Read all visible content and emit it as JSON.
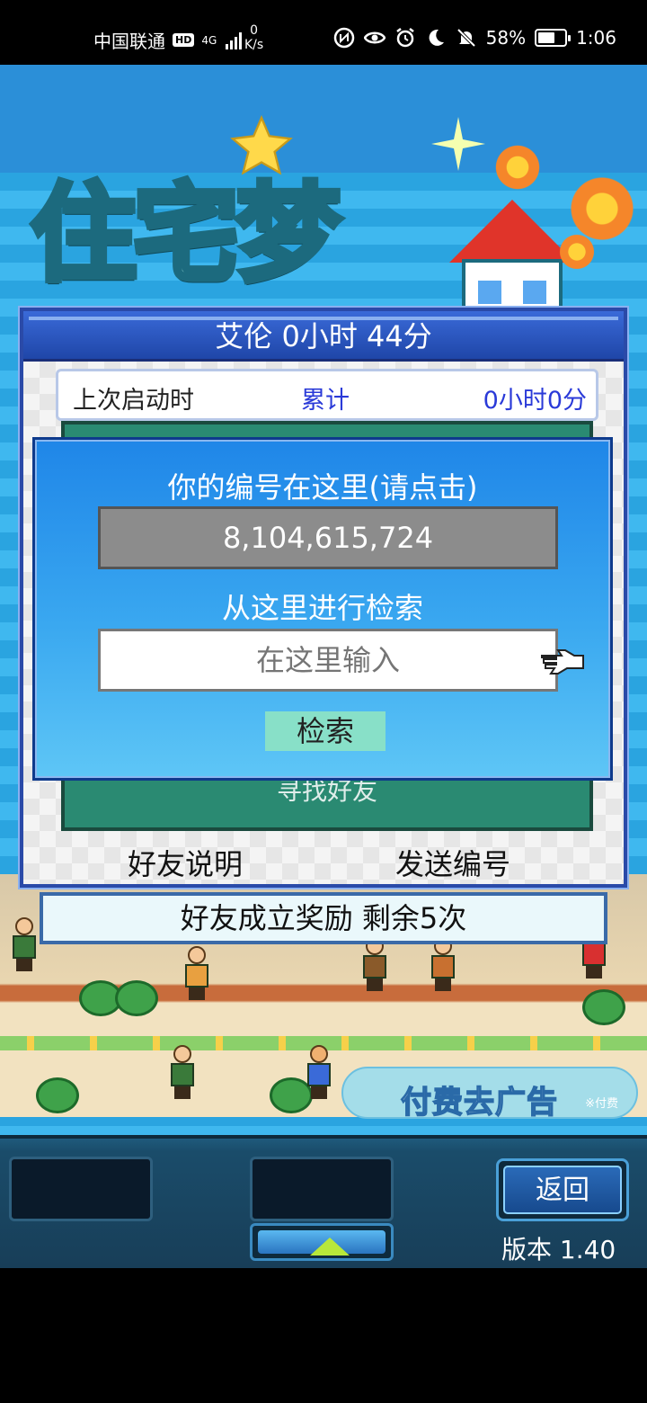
{
  "status_bar": {
    "carrier": "中国联通",
    "hd_badge": "HD",
    "network": "4G",
    "speed_value": "0",
    "speed_unit": "K/s",
    "battery_percent": "58%",
    "time": "1:06"
  },
  "game": {
    "logo_text": "住宅梦",
    "ad_banner": {
      "label": "付费去广告",
      "note": "※付费"
    }
  },
  "dialog": {
    "title": "艾伦  0小时 44分",
    "info": {
      "left": "上次启动时",
      "middle": "累计",
      "right": "0小时0分"
    },
    "find_friend_label": "寻找好友",
    "friend_help": "好友说明",
    "send_id": "发送编号"
  },
  "reward_bar": "好友成立奖励  剩余5次",
  "id_panel": {
    "id_label": "你的编号在这里(请点击)",
    "id_value": "8,104,615,724",
    "search_label": "从这里进行检索",
    "search_placeholder": "在这里输入",
    "search_button": "检索"
  },
  "bottom_bar": {
    "back_button": "返回",
    "version": "版本 1.40"
  },
  "colors": {
    "panel_blue": "#1f86e8",
    "dialog_border": "#2a4aa8",
    "link_blue": "#2a3ad8",
    "search_button": "#88e0c8"
  }
}
